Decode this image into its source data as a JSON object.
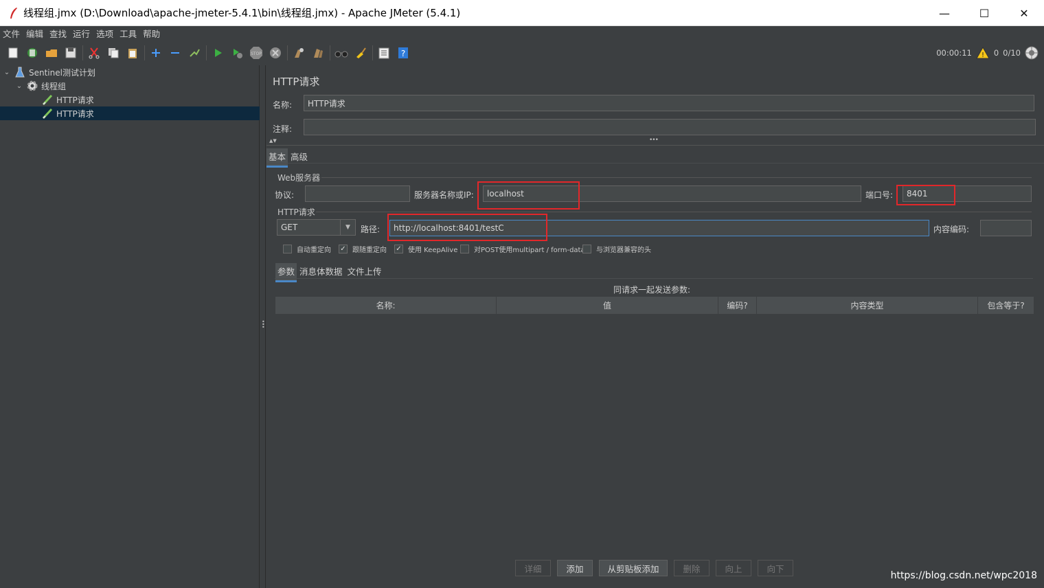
{
  "window": {
    "title": "线程组.jmx (D:\\Download\\apache-jmeter-5.4.1\\bin\\线程组.jmx) - Apache JMeter (5.4.1)",
    "minimize": "—",
    "maximize": "☐",
    "close": "✕"
  },
  "menu": [
    "文件",
    "编辑",
    "查找",
    "运行",
    "选项",
    "工具",
    "帮助"
  ],
  "toolbar": {
    "timer": "00:00:11",
    "warnings": "0",
    "threads": "0/10"
  },
  "tree": {
    "items": [
      {
        "label": "Sentinel测试计划",
        "level": 0
      },
      {
        "label": "线程组",
        "level": 1
      },
      {
        "label": "HTTP请求",
        "level": 2
      },
      {
        "label": "HTTP请求",
        "level": 2,
        "selected": true
      }
    ]
  },
  "panel": {
    "title": "HTTP请求",
    "name_label": "名称:",
    "name_value": "HTTP请求",
    "comment_label": "注释:",
    "comment_value": "",
    "tabs": [
      "基本",
      "高级"
    ],
    "web_server": {
      "group_title": "Web服务器",
      "protocol_label": "协议:",
      "protocol_value": "",
      "server_label": "服务器名称或IP:",
      "server_value": "localhost",
      "port_label": "端口号:",
      "port_value": "8401"
    },
    "http_request": {
      "group_title": "HTTP请求",
      "method": "GET",
      "path_label": "路径:",
      "path_value": "http://localhost:8401/testC",
      "encoding_label": "内容编码:",
      "encoding_value": ""
    },
    "options": [
      {
        "label": "自动重定向",
        "checked": false
      },
      {
        "label": "跟随重定向",
        "checked": true
      },
      {
        "label": "使用 KeepAlive",
        "checked": true
      },
      {
        "label": "对POST使用multipart / form-data",
        "checked": false
      },
      {
        "label": "与浏览器兼容的头",
        "checked": false
      }
    ],
    "sub_tabs": [
      "参数",
      "消息体数据",
      "文件上传"
    ],
    "params_caption": "同请求一起发送参数:",
    "columns": [
      "名称:",
      "值",
      "编码?",
      "内容类型",
      "包含等于?"
    ],
    "buttons": {
      "detail": "详细",
      "add": "添加",
      "add_clipboard": "从剪贴板添加",
      "delete": "删除",
      "up": "向上",
      "down": "向下"
    }
  },
  "watermark": "https://blog.csdn.net/wpc2018",
  "colors": {
    "background": "#3c3f41",
    "highlight": "#e3272a",
    "selection": "#0d293e",
    "accent": "#4a88c7"
  }
}
